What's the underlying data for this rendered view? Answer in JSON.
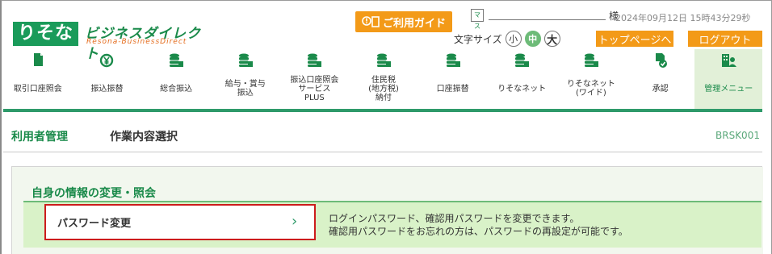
{
  "header": {
    "logo_main": "りそな",
    "logo_service": "ビジネスダイレクト",
    "logo_sub": "Resona-BusinessDirect",
    "guide_label": "ご利用ガイド",
    "user_icon_text": "マス",
    "user_suffix": "様",
    "datetime": "2024年09月12日 15時43分29秒",
    "fontsize_label": "文字サイズ",
    "fontsize_small": "小",
    "fontsize_medium": "中",
    "fontsize_large": "大",
    "top_page_label": "トップページへ",
    "logout_label": "ログアウト"
  },
  "nav": {
    "items": [
      {
        "label": "取引口座照会",
        "icon": "document-icon"
      },
      {
        "label": "振込振替",
        "icon": "yen-icon"
      },
      {
        "label": "総合振込",
        "icon": "coin-stack-icon"
      },
      {
        "label": "給与・賞与\n振込",
        "icon": "coin-stack-icon"
      },
      {
        "label": "振込口座照会\nサービス\nPLUS",
        "icon": "coin-stack-icon"
      },
      {
        "label": "住民税\n(地方税)\n納付",
        "icon": "coin-stack-icon"
      },
      {
        "label": "口座振替",
        "icon": "coin-stack-icon"
      },
      {
        "label": "りそなネット",
        "icon": "coin-stack-icon"
      },
      {
        "label": "りそなネット\n(ワイド)",
        "icon": "coin-stack-icon"
      },
      {
        "label": "承認",
        "icon": "approve-icon"
      },
      {
        "label": "管理メニュー",
        "icon": "admin-icon",
        "active": true
      }
    ]
  },
  "page": {
    "category": "利用者管理",
    "title": "作業内容選択",
    "code": "BRSK001"
  },
  "section": {
    "title": "自身の情報の変更・照会",
    "password_button": "パスワード変更",
    "chevron": "›",
    "desc_line1": "ログインパスワード、確認用パスワードを変更できます。",
    "desc_line2": "確認用パスワードをお忘れの方は、パスワードの再設定が可能です。"
  },
  "colors": {
    "brand_green": "#1a9b5a",
    "accent_orange": "#f39a18",
    "nav_bar": "#2e9a6a",
    "highlight_red": "#cc1c1c"
  }
}
